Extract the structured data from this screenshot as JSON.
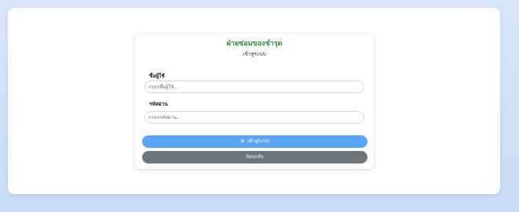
{
  "card": {
    "title": "ฝ่ายซ่อมของชำรุด",
    "subtitle": "เข้าสู่ระบบ"
  },
  "form": {
    "username_label": "ชื่อผู้ใช้",
    "username_placeholder": "กรอกชื่อผู้ใช้..",
    "password_label": "รหัสผ่าน",
    "password_placeholder": "กรอกรหัสผ่าน.."
  },
  "buttons": {
    "login_icon": "⊕",
    "login_label": "เข้าสู่ระบบ",
    "back_label": "ย้อนกลับ"
  },
  "icons": {
    "login_icon_name": "login-icon"
  },
  "colors": {
    "title": "#2e8b3e",
    "login_button": "#5aa6f5",
    "back_button": "#6c757d",
    "background": "#cddff5"
  }
}
